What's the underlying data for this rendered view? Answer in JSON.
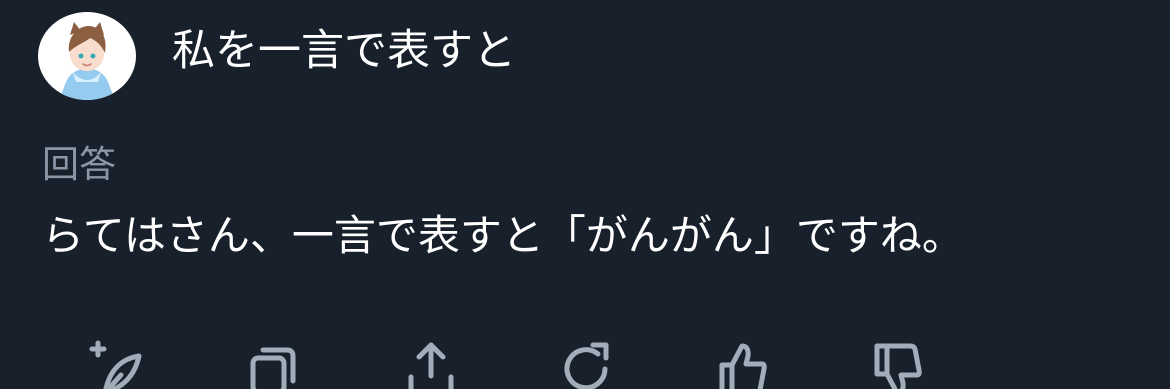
{
  "question": {
    "title": "私を一言で表すと"
  },
  "answer": {
    "label": "回答",
    "text": "らてはさん、一言で表すと「がんがん」ですね。"
  },
  "colors": {
    "background": "#17202b",
    "title_text": "#ffffff",
    "label_text": "#8b97a6",
    "icon": "#a3adba"
  },
  "icons": {
    "avatar": "avatar-character",
    "actions": [
      "new-post-icon",
      "copy-icon",
      "share-icon",
      "regenerate-icon",
      "thumbs-up-icon",
      "thumbs-down-icon"
    ]
  }
}
